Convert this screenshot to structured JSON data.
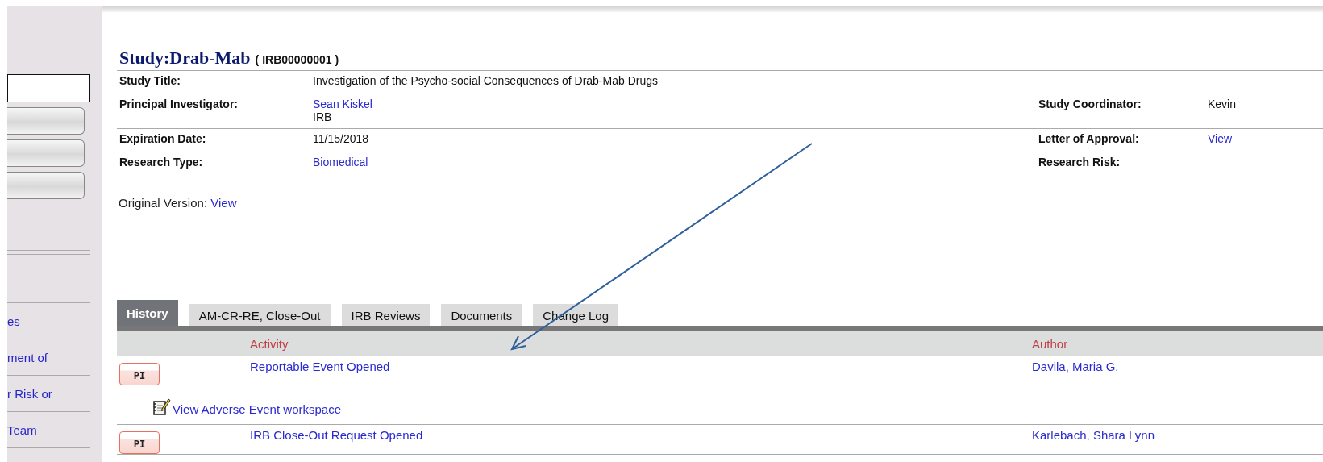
{
  "sidebar": {
    "items": [
      {
        "label": "es"
      },
      {
        "label": "ment of"
      },
      {
        "label": "r Risk or"
      },
      {
        "label": "Team"
      }
    ]
  },
  "study": {
    "name": "Study:Drab-Mab",
    "id": "( IRB00000001 )"
  },
  "details": [
    {
      "label": "Study Title:",
      "values": [
        {
          "text": "Investigation of the Psycho-social Consequences of Drab-Mab Drugs",
          "kind": "text"
        }
      ]
    },
    {
      "label": "Principal Investigator:",
      "values": [
        {
          "text": "Sean Kiskel",
          "kind": "link"
        },
        {
          "text": "IRB",
          "kind": "text"
        }
      ],
      "right_label": "Study Coordinator:",
      "right_value": {
        "text": "Kevin",
        "kind": "text"
      }
    },
    {
      "label": "Expiration Date:",
      "values": [
        {
          "text": "11/15/2018",
          "kind": "text"
        }
      ],
      "right_label": "Letter of Approval:",
      "right_value": {
        "text": "View",
        "kind": "link"
      }
    },
    {
      "label": "Research Type:",
      "values": [
        {
          "text": "Biomedical",
          "kind": "link"
        }
      ],
      "right_label": "Research Risk:"
    }
  ],
  "original_version": {
    "label": "Original Version:",
    "link": "View"
  },
  "tabs": [
    {
      "label": "History",
      "selected": true
    },
    {
      "label": "AM-CR-RE, Close-Out",
      "selected": false
    },
    {
      "label": "IRB Reviews",
      "selected": false
    },
    {
      "label": "Documents",
      "selected": false
    },
    {
      "label": "Change Log",
      "selected": false
    }
  ],
  "history": {
    "columns": [
      "Activity",
      "Author"
    ],
    "rows": [
      {
        "badge": "PI",
        "activity": "Reportable Event Opened",
        "author": "Davila, Maria G.",
        "workspace_link": "View Adverse Event workspace"
      },
      {
        "badge": "PI",
        "activity": "IRB Close-Out Request Opened",
        "author": "Karlebach, Shara Lynn"
      }
    ]
  }
}
